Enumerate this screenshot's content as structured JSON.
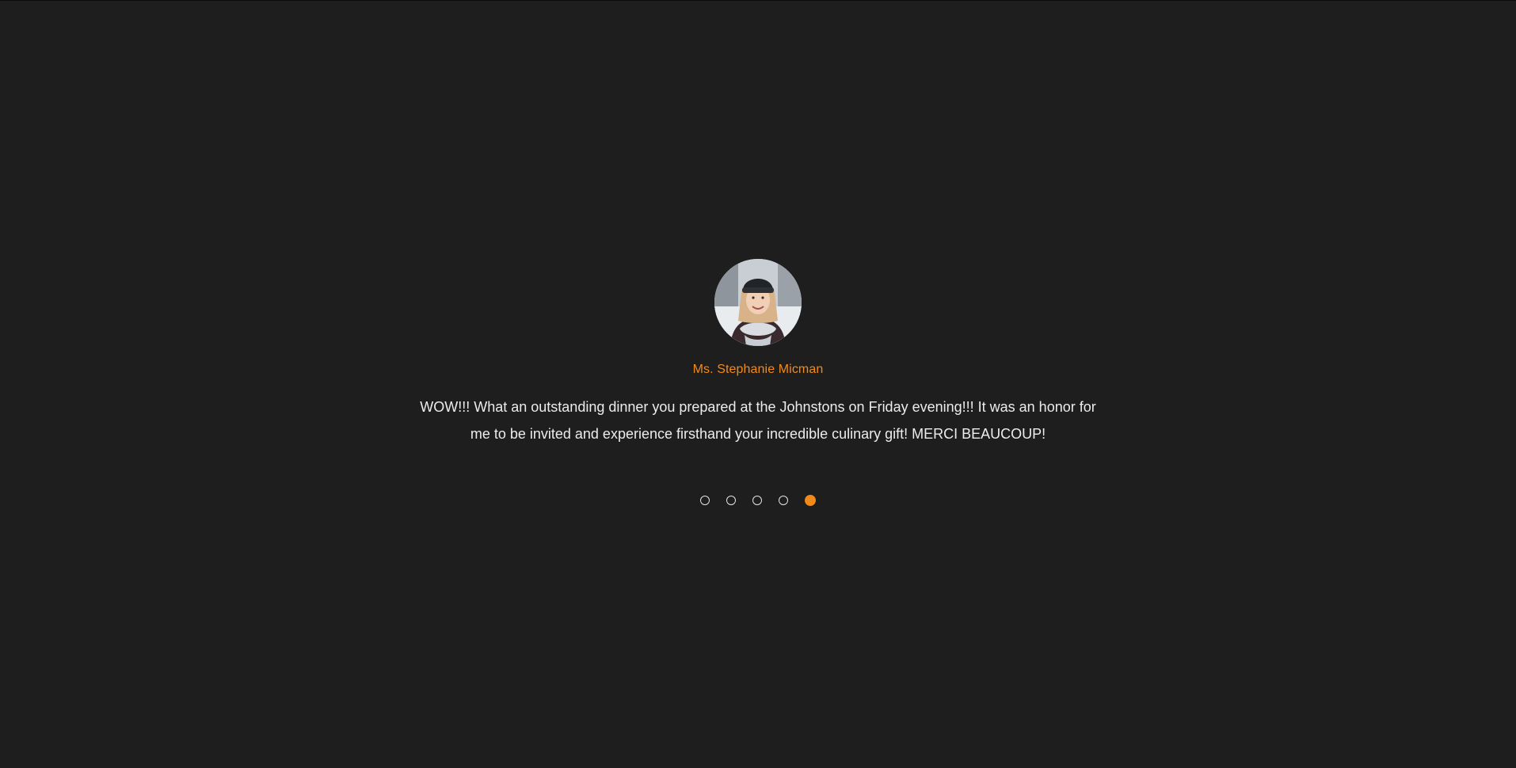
{
  "testimonial": {
    "author": "Ms. Stephanie Micman",
    "quote": "WOW!!! What an outstanding dinner you prepared at the Johnstons on Friday evening!!! It was an honor for me to be invited and experience firsthand your incredible culinary gift! MERCI BEAUCOUP!",
    "avatar_icon": "person-photo-icon"
  },
  "pagination": {
    "total": 5,
    "active_index": 4
  },
  "colors": {
    "background": "#1e1e1e",
    "accent": "#f28a1a",
    "text": "#ececec"
  }
}
